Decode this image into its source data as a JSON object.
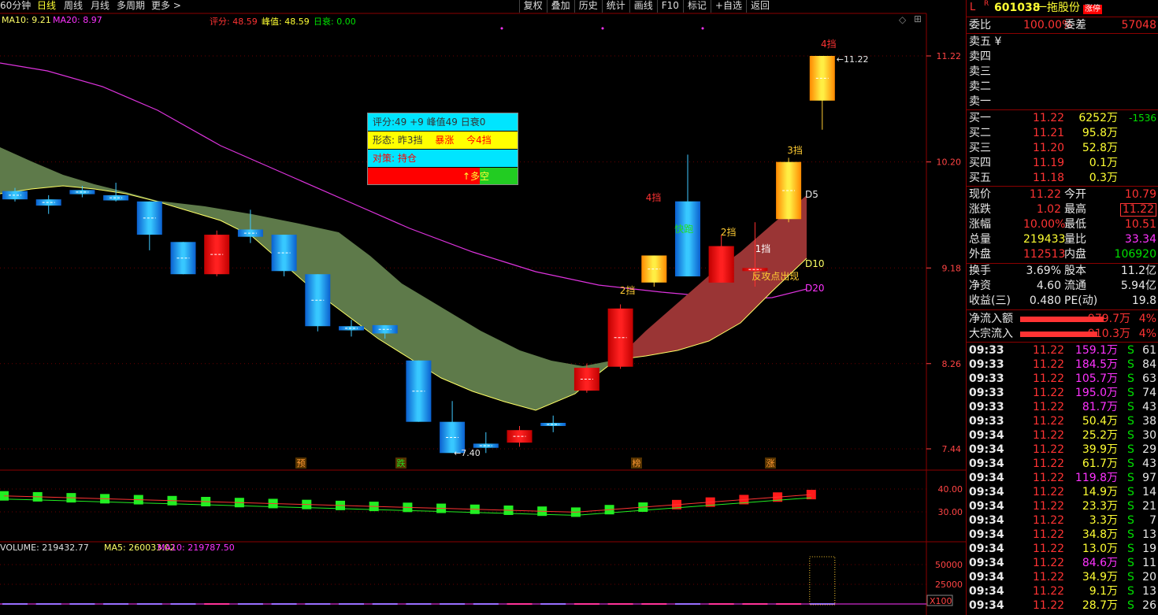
{
  "toolbar": {
    "tabs": [
      "60分钟",
      "日线",
      "周线",
      "月线",
      "多周期",
      "更多 >"
    ],
    "active_tab": 1,
    "buttons": [
      "复权",
      "叠加",
      "历史",
      "统计",
      "画线",
      "F10",
      "标记",
      "+自选",
      "返回"
    ]
  },
  "indicators": {
    "ma10": "MA10: 9.21",
    "ma20": "MA20: 8.97",
    "score": "评分: 48.59",
    "peak": "峰值: 48.59",
    "decay": "日衰: 0.00",
    "volume": "VOLUME: 219432.77",
    "vma5": "MA5: 260033.02",
    "vma10": "MA10: 219787.50"
  },
  "info_box": {
    "row1": "评分:49  +9    峰值49   日衰0",
    "row2_a": "形态: 昨3挡",
    "row2_b": "暴涨",
    "row2_c": "今4挡",
    "row3": "对策: 持仓",
    "row4": "↑多空"
  },
  "chart_data": {
    "type": "candlestick",
    "price_axis": [
      "11.22",
      "10.20",
      "9.18",
      "8.26",
      "7.44"
    ],
    "sub_axis": [
      "40.00",
      "30.00"
    ],
    "vol_axis": [
      "50000",
      "25000"
    ],
    "vol_unit": "X100",
    "candles": [
      {
        "o": 9.92,
        "h": 9.95,
        "l": 9.82,
        "c": 9.84
      },
      {
        "o": 9.84,
        "h": 9.88,
        "l": 9.7,
        "c": 9.78
      },
      {
        "o": 9.93,
        "h": 9.97,
        "l": 9.86,
        "c": 9.89
      },
      {
        "o": 9.88,
        "h": 10.0,
        "l": 9.82,
        "c": 9.83
      },
      {
        "o": 9.82,
        "h": 9.82,
        "l": 9.35,
        "c": 9.5
      },
      {
        "o": 9.43,
        "h": 9.43,
        "l": 9.12,
        "c": 9.12
      },
      {
        "o": 9.12,
        "h": 9.54,
        "l": 9.1,
        "c": 9.5
      },
      {
        "o": 9.55,
        "h": 9.74,
        "l": 9.42,
        "c": 9.48
      },
      {
        "o": 9.5,
        "h": 9.5,
        "l": 9.1,
        "c": 9.15
      },
      {
        "o": 9.12,
        "h": 9.12,
        "l": 8.57,
        "c": 8.62
      },
      {
        "o": 8.62,
        "h": 8.68,
        "l": 8.52,
        "c": 8.58
      },
      {
        "o": 8.63,
        "h": 8.63,
        "l": 8.5,
        "c": 8.55
      },
      {
        "o": 8.29,
        "h": 8.29,
        "l": 7.7,
        "c": 7.7
      },
      {
        "o": 7.7,
        "h": 7.9,
        "l": 7.4,
        "c": 7.4
      },
      {
        "o": 7.49,
        "h": 7.6,
        "l": 7.4,
        "c": 7.45
      },
      {
        "o": 7.5,
        "h": 7.66,
        "l": 7.46,
        "c": 7.62
      },
      {
        "o": 7.69,
        "h": 7.76,
        "l": 7.6,
        "c": 7.66
      },
      {
        "o": 8.0,
        "h": 8.26,
        "l": 7.98,
        "c": 8.22
      },
      {
        "o": 8.23,
        "h": 8.83,
        "l": 8.21,
        "c": 8.79
      },
      {
        "o": 9.04,
        "h": 9.3,
        "l": 9.0,
        "c": 9.3
      },
      {
        "o": 9.82,
        "h": 10.27,
        "l": 9.1,
        "c": 9.1
      },
      {
        "o": 9.04,
        "h": 9.5,
        "l": 9.04,
        "c": 9.39
      },
      {
        "o": 9.15,
        "h": 9.62,
        "l": 9.0,
        "c": 9.18
      },
      {
        "o": 9.65,
        "h": 10.24,
        "l": 9.62,
        "c": 10.2
      },
      {
        "o": 11.22,
        "h": 11.22,
        "l": 10.51,
        "c": 10.79
      }
    ],
    "annotations": [
      {
        "text": "4挡",
        "candle": 24
      },
      {
        "text": "3挡",
        "candle": 23
      },
      {
        "text": "4挡",
        "candle": 18
      },
      {
        "text": "2挡",
        "candle": 21
      },
      {
        "text": "1挡",
        "candle": 22
      },
      {
        "text": "2挡",
        "candle": 18
      },
      {
        "text": "快跑",
        "candle": 19
      },
      {
        "text": "反攻点出现",
        "candle": 22
      },
      {
        "text": "11.22",
        "candle": 24
      },
      {
        "text": "7.40",
        "candle": 13
      }
    ],
    "band_labels": [
      "D5",
      "D10",
      "D20"
    ],
    "event_labels": [
      {
        "text": "预",
        "candle": 8
      },
      {
        "text": "跌",
        "candle": 11
      },
      {
        "text": "榜",
        "candle": 19
      },
      {
        "text": "涨",
        "candle": 22
      }
    ]
  },
  "quote": {
    "code": "601038",
    "name": "一拖股份",
    "badge": "涨停",
    "flag": "L",
    "flag2": "R",
    "weibi_label": "委比",
    "weibi": "100.00%",
    "weicha_label": "委差",
    "weicha": "57048",
    "sells": [
      "卖五 ¥",
      "卖四",
      "卖三",
      "卖二",
      "卖一"
    ],
    "buys": [
      {
        "label": "买一",
        "price": "11.22",
        "vol": "6252万",
        "chg": "-1536"
      },
      {
        "label": "买二",
        "price": "11.21",
        "vol": "95.8万",
        "chg": ""
      },
      {
        "label": "买三",
        "price": "11.20",
        "vol": "52.8万",
        "chg": ""
      },
      {
        "label": "买四",
        "price": "11.19",
        "vol": "0.1万",
        "chg": ""
      },
      {
        "label": "买五",
        "price": "11.18",
        "vol": "0.3万",
        "chg": ""
      }
    ],
    "stats": [
      {
        "l1": "现价",
        "v1": "11.22",
        "l2": "今开",
        "v2": "10.79"
      },
      {
        "l1": "涨跌",
        "v1": "1.02",
        "l2": "最高",
        "v2": "11.22"
      },
      {
        "l1": "涨幅",
        "v1": "10.00%",
        "l2": "最低",
        "v2": "10.51"
      },
      {
        "l1": "总量",
        "v1": "219433",
        "l2": "量比",
        "v2": "33.34"
      },
      {
        "l1": "外盘",
        "v1": "112513",
        "l2": "内盘",
        "v2": "106920"
      }
    ],
    "stats2": [
      {
        "l1": "换手",
        "v1": "3.69%",
        "l2": "股本",
        "v2": "11.2亿"
      },
      {
        "l1": "净资",
        "v1": "4.60",
        "l2": "流通",
        "v2": "5.94亿"
      },
      {
        "l1": "收益(三)",
        "v1": "0.480",
        "l2": "PE(动)",
        "v2": "19.8"
      }
    ],
    "flows": [
      {
        "label": "净流入额",
        "val": "979.7万",
        "pct": "4%"
      },
      {
        "label": "大宗流入",
        "val": "910.3万",
        "pct": "4%"
      }
    ],
    "ticks": [
      {
        "t": "09:33",
        "p": "11.22",
        "v": "159.1万",
        "s": "S",
        "n": "61"
      },
      {
        "t": "09:33",
        "p": "11.22",
        "v": "184.5万",
        "s": "S",
        "n": "84"
      },
      {
        "t": "09:33",
        "p": "11.22",
        "v": "105.7万",
        "s": "S",
        "n": "63"
      },
      {
        "t": "09:33",
        "p": "11.22",
        "v": "195.0万",
        "s": "S",
        "n": "74"
      },
      {
        "t": "09:33",
        "p": "11.22",
        "v": "81.7万",
        "s": "S",
        "n": "43"
      },
      {
        "t": "09:33",
        "p": "11.22",
        "v": "50.4万",
        "s": "S",
        "n": "38"
      },
      {
        "t": "09:34",
        "p": "11.22",
        "v": "25.2万",
        "s": "S",
        "n": "30"
      },
      {
        "t": "09:34",
        "p": "11.22",
        "v": "39.9万",
        "s": "S",
        "n": "29"
      },
      {
        "t": "09:34",
        "p": "11.22",
        "v": "61.7万",
        "s": "S",
        "n": "43"
      },
      {
        "t": "09:34",
        "p": "11.22",
        "v": "119.8万",
        "s": "S",
        "n": "97"
      },
      {
        "t": "09:34",
        "p": "11.22",
        "v": "14.9万",
        "s": "S",
        "n": "14"
      },
      {
        "t": "09:34",
        "p": "11.22",
        "v": "23.3万",
        "s": "S",
        "n": "21"
      },
      {
        "t": "09:34",
        "p": "11.22",
        "v": "3.3万",
        "s": "S",
        "n": "7"
      },
      {
        "t": "09:34",
        "p": "11.22",
        "v": "34.8万",
        "s": "S",
        "n": "13"
      },
      {
        "t": "09:34",
        "p": "11.22",
        "v": "13.0万",
        "s": "S",
        "n": "19"
      },
      {
        "t": "09:34",
        "p": "11.22",
        "v": "84.6万",
        "s": "S",
        "n": "11"
      },
      {
        "t": "09:34",
        "p": "11.22",
        "v": "34.9万",
        "s": "S",
        "n": "20"
      },
      {
        "t": "09:34",
        "p": "11.22",
        "v": "9.1万",
        "s": "S",
        "n": "13"
      },
      {
        "t": "09:34",
        "p": "11.22",
        "v": "28.7万",
        "s": "S",
        "n": "26"
      }
    ]
  },
  "colors": {
    "up": "#ff1a1a",
    "down": "#1e90ff",
    "ma10": "#ffff66",
    "ma20": "#dd33dd",
    "band_down": "#5e7a4a",
    "band_up": "#9a3535"
  }
}
